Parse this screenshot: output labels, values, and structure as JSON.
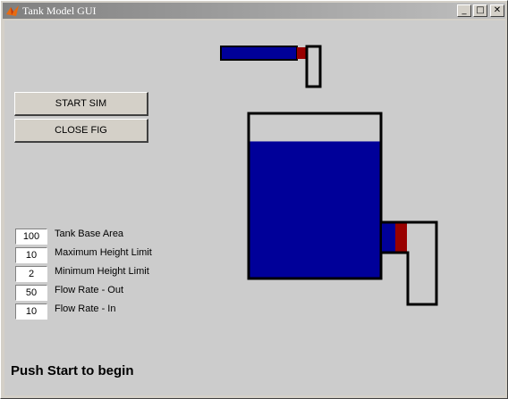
{
  "window": {
    "title": "Tank Model GUI",
    "controls": {
      "minimize": "_",
      "maximize": "□",
      "close": "✕"
    }
  },
  "buttons": {
    "start": "START SIM",
    "close": "CLOSE FIG"
  },
  "params": [
    {
      "value": "100",
      "label": "Tank Base Area"
    },
    {
      "value": "10",
      "label": "Maximum Height Limit"
    },
    {
      "value": "2",
      "label": "Minimum Height Limit"
    },
    {
      "value": "50",
      "label": "Flow Rate - Out"
    },
    {
      "value": "10",
      "label": "Flow Rate - In"
    }
  ],
  "status_text": "Push Start to begin",
  "colors": {
    "water": "#000099",
    "valve": "#990000",
    "outline": "#000000",
    "background": "#cccccc"
  },
  "tank": {
    "fill_fraction": 0.83
  }
}
